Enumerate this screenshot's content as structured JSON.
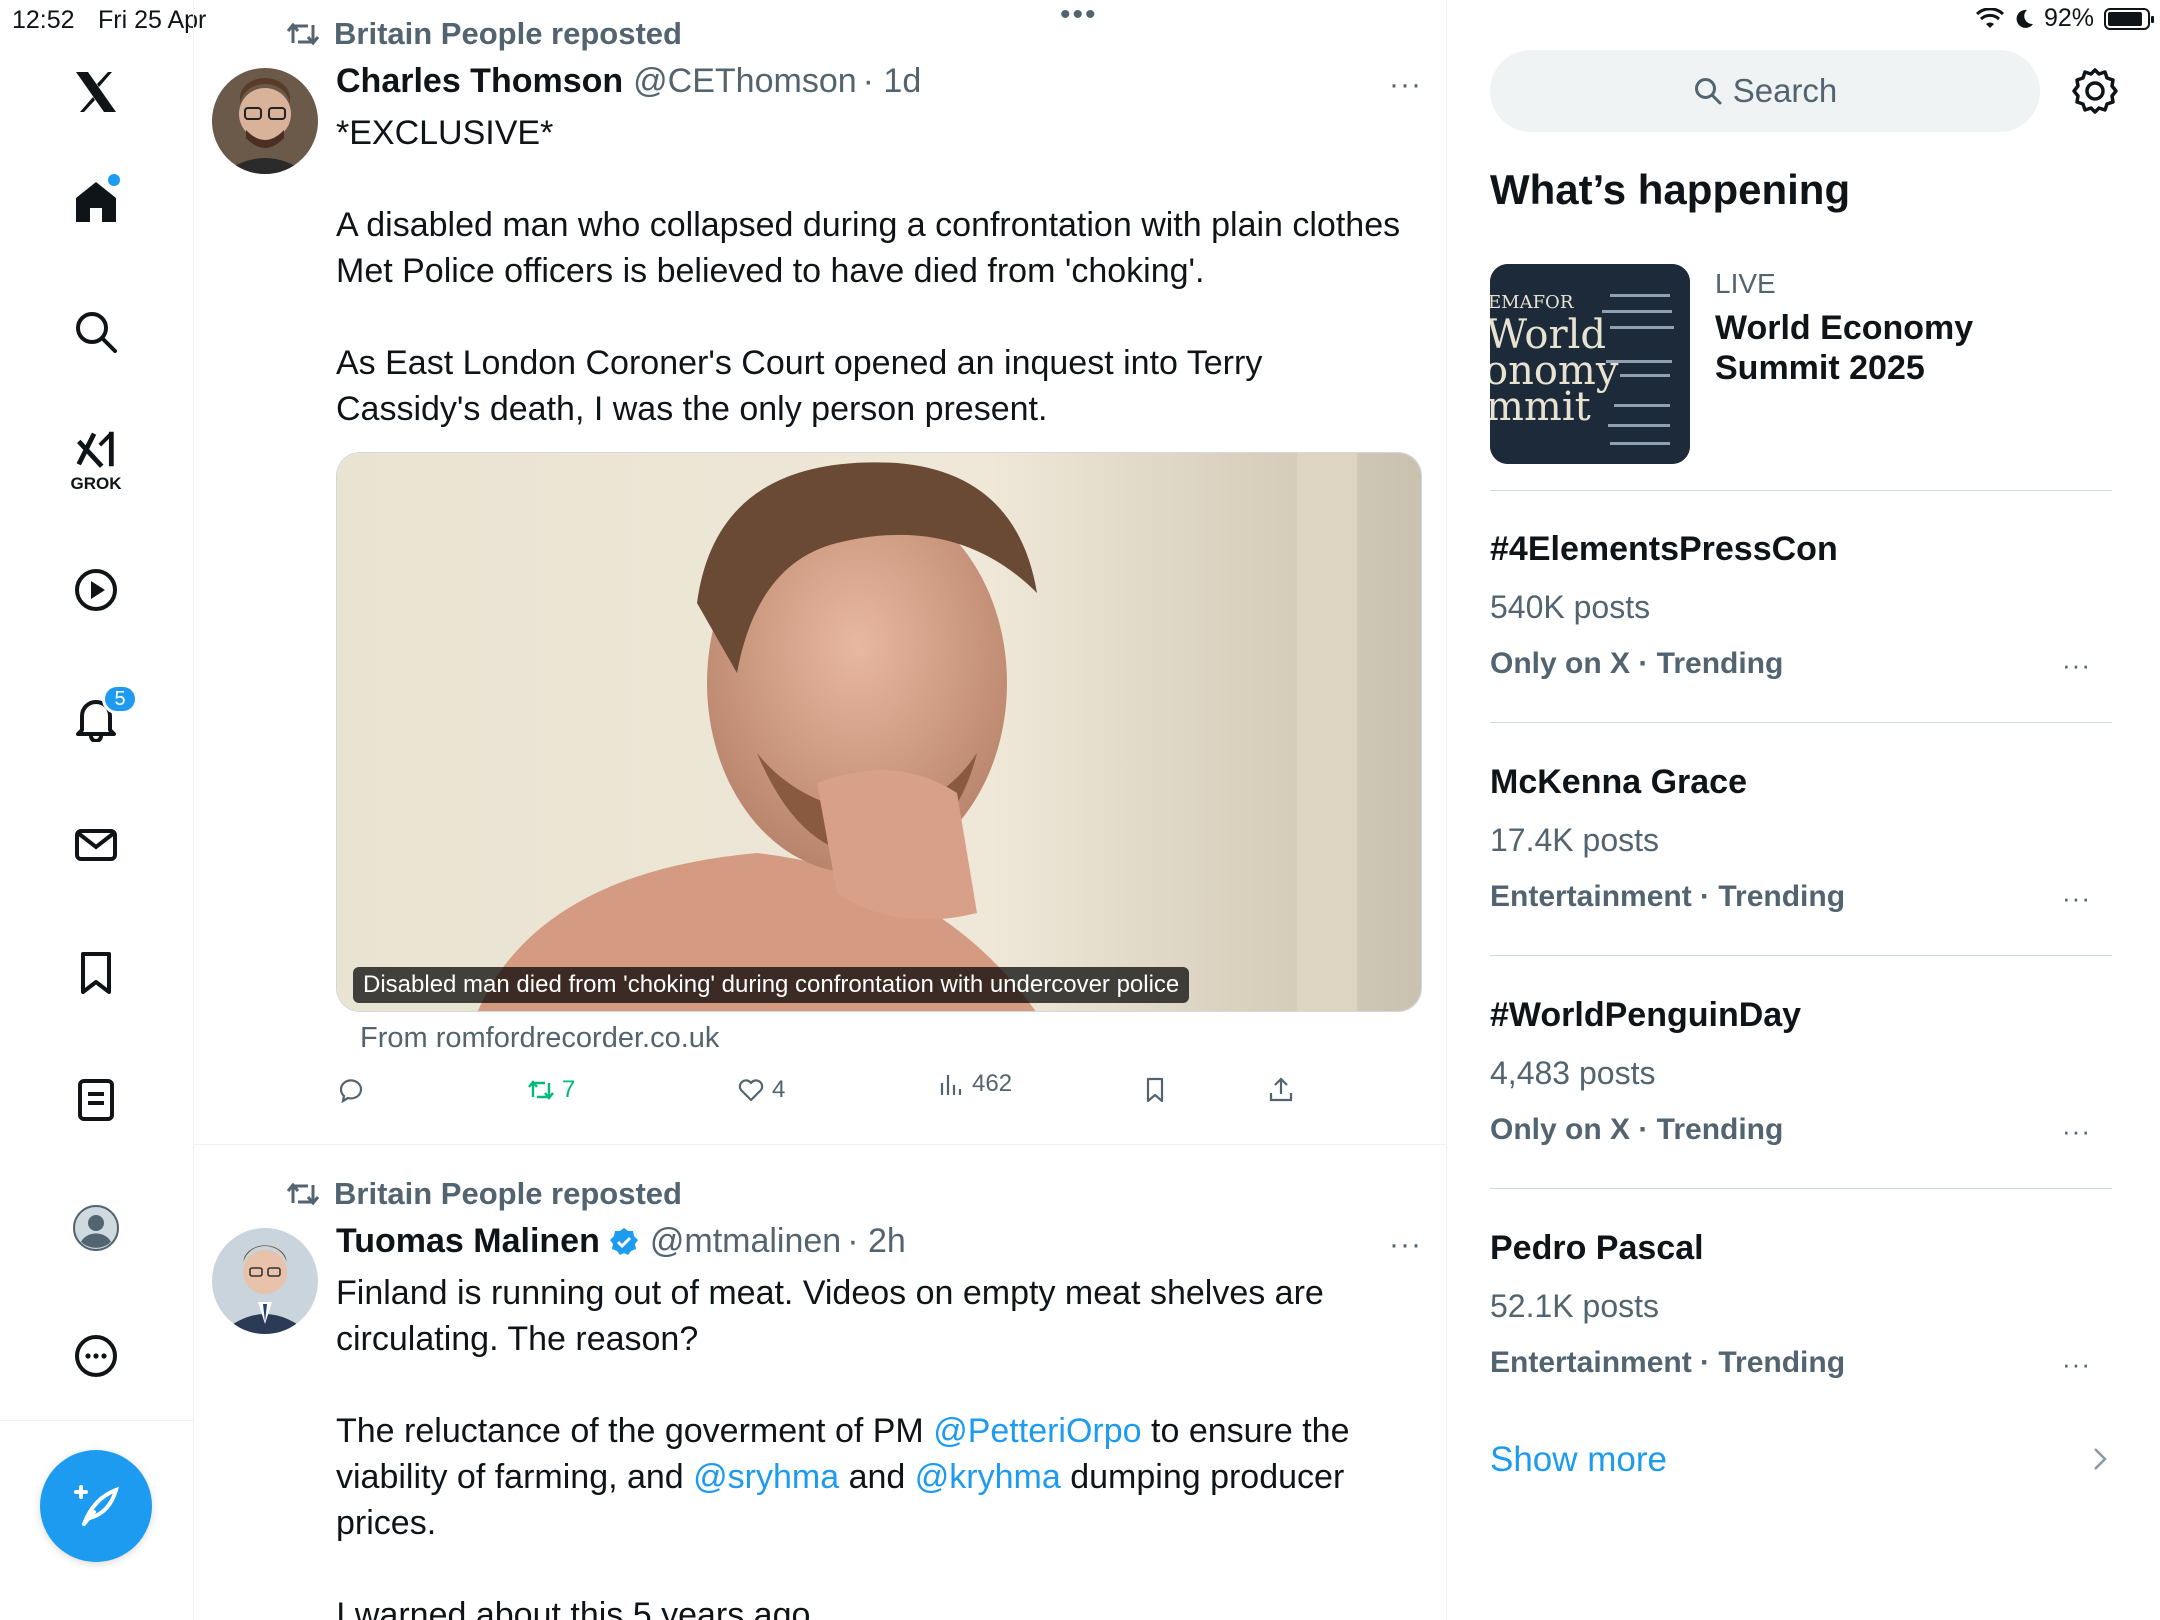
{
  "status_bar": {
    "time": "12:52",
    "date": "Fri 25 Apr",
    "battery": "92%"
  },
  "nav": {
    "logo": "x-logo-icon",
    "items": [
      "home-icon",
      "search-icon",
      "grok-icon",
      "video-icon",
      "notifications-icon",
      "messages-icon",
      "bookmarks-icon",
      "lists-icon",
      "profile-icon",
      "more-icon"
    ],
    "grok_label": "GROK",
    "notifications_badge": "5",
    "compose": "compose-icon"
  },
  "timeline": {
    "posts": [
      {
        "reposted_by": "Britain People reposted",
        "name": "Charles Thomson",
        "handle": "@CEThomson",
        "time": "· 1d",
        "more": "···",
        "text_1": "*EXCLUSIVE*",
        "text_2": "A disabled man who collapsed during a confrontation with plain clothes Met Police officers is believed to have died from 'choking'.",
        "text_3": "As East London Coroner's Court opened an inquest into Terry Cassidy's death, I was the only person present.",
        "media_caption": "Disabled man died from 'choking' during confrontation with undercover police",
        "media_source": "From romfordrecorder.co.uk",
        "reposts": "7",
        "likes": "4",
        "views": "462"
      },
      {
        "reposted_by": "Britain People reposted",
        "name": "Tuomas Malinen",
        "handle": "@mtmalinen",
        "time": "· 2h",
        "more": "···",
        "text_1": "Finland is running out of meat. Videos on empty meat shelves are circulating. The reason?",
        "text_2a": "The reluctance of the goverment of PM ",
        "mention_1": "@PetteriOrpo",
        "text_2b": " to ensure the viability of farming, and ",
        "mention_2": "@sryhma",
        "text_2c": " and ",
        "mention_3": "@kryhma",
        "text_2d": " dumping producer prices.",
        "text_3": "I warned about this 5 years ago"
      }
    ]
  },
  "sidebar": {
    "search_placeholder": "Search",
    "title": "What’s happening",
    "event": {
      "live": "LIVE",
      "title": "World Economy Summit 2025",
      "thumb_lines": [
        "EMAFOR",
        "World",
        "onomy",
        "mmit"
      ]
    },
    "trends": [
      {
        "name": "#4ElementsPressCon",
        "count": "540K posts",
        "category": "Only on X · Trending"
      },
      {
        "name": "McKenna Grace",
        "count": "17.4K posts",
        "category": "Entertainment · Trending"
      },
      {
        "name": "#WorldPenguinDay",
        "count": "4,483 posts",
        "category": "Only on X · Trending"
      },
      {
        "name": "Pedro Pascal",
        "count": "52.1K posts",
        "category": "Entertainment · Trending"
      }
    ],
    "trend_more": "···",
    "show_more": "Show more"
  },
  "colors": {
    "accent": "#1d9bf0",
    "repost_green": "#00ba7c",
    "muted": "#536471"
  }
}
